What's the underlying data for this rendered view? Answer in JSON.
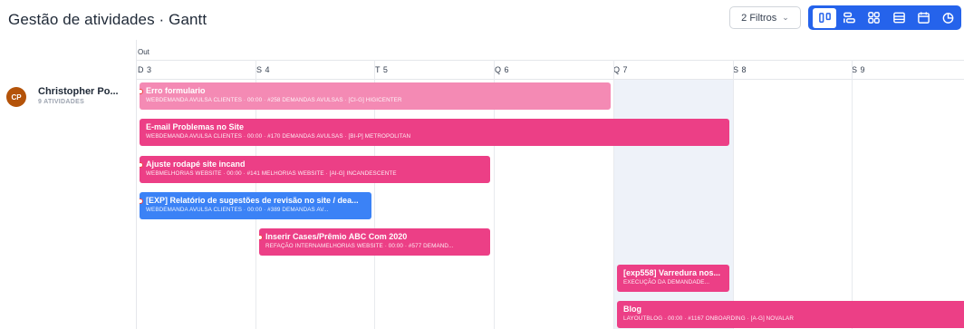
{
  "header": {
    "title": "Gestão de atividades · Gantt",
    "filters_label": "2 Filtros",
    "accent_color": "#2563eb",
    "view_buttons": [
      {
        "name": "columns-icon",
        "active": true
      },
      {
        "name": "gantt-icon",
        "active": false
      },
      {
        "name": "grid-icon",
        "active": false
      },
      {
        "name": "list-icon",
        "active": false
      },
      {
        "name": "calendar-icon",
        "active": false
      },
      {
        "name": "pie-chart-icon",
        "active": false
      }
    ]
  },
  "timeline": {
    "month": "Out",
    "days": [
      "D 3",
      "S 4",
      "T 5",
      "Q 6",
      "Q 7",
      "S 8",
      "S 9"
    ]
  },
  "user": {
    "initials": "CP",
    "name": "Christopher Po...",
    "activities": "9 ATIVIDADES"
  },
  "tasks": [
    {
      "title": "Erro formulario",
      "subtitle": "WEBDEMANDA AVULSA CLIENTES · 00:00 · #258 DEMANDAS AVULSAS · [CI-G] HIGICENTER",
      "color": "#f48ab4"
    },
    {
      "title": "E-mail Problemas no Site",
      "subtitle": "WEBDEMANDA AVULSA CLIENTES · 00:00 · #170 DEMANDAS AVULSAS · [BI-P] METROPOLITAN",
      "color": "#ec3f86"
    },
    {
      "title": "Ajuste rodapé site incand",
      "subtitle": "WEBMELHORIAS WEBSITE · 00:00 · #141 MELHORIAS WEBSITE · [AI-G] INCANDESCENTE",
      "color": "#ec3f86"
    },
    {
      "title": "[EXP] Relatório de sugestões de revisão no site / dea...",
      "subtitle": "WEBDEMANDA AVULSA CLIENTES · 00:00 · #389 DEMANDAS AV...",
      "color": "#3b82f6"
    },
    {
      "title": "Inserir Cases/Prêmio ABC Com 2020",
      "subtitle": "REFAÇÃO INTERNAMELHORIAS WEBSITE · 00:00 · #577 DEMAND...",
      "color": "#ec3f86"
    },
    {
      "title": "[exp558] Varredura nos...",
      "subtitle": "EXECUÇÃO DA DEMANDADE...",
      "color": "#ec3f86"
    },
    {
      "title": "Blog",
      "subtitle": "LAYOUTBLOG · 00:00 · #1167 ONBOARDING · [A-G] NOVALAR",
      "color": "#ec3f86"
    }
  ]
}
